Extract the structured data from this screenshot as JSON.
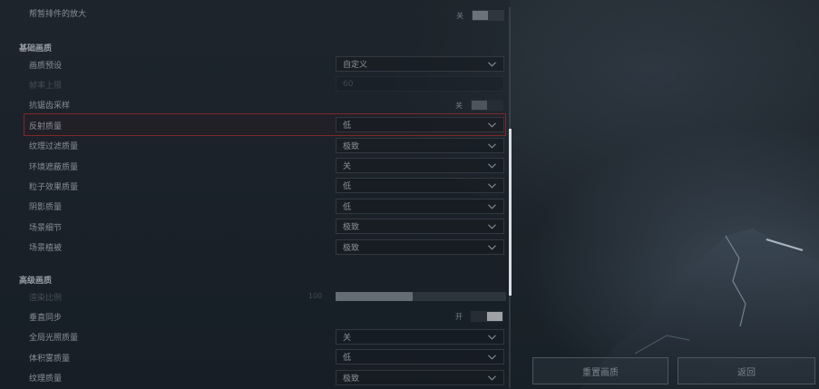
{
  "top_row": {
    "label": "帮暂排件的放大",
    "toggle_text": "关"
  },
  "basic_section": {
    "title": "基础画质",
    "rows": [
      {
        "label": "画质预设",
        "value": "自定义",
        "type": "dropdown",
        "disabled": false
      },
      {
        "label": "帧率上限",
        "value": "60",
        "type": "dropdown",
        "disabled": true
      },
      {
        "label": "抗锯齿采样",
        "value": "关",
        "type": "toggle",
        "disabled": false
      },
      {
        "label": "反射质量",
        "value": "低",
        "type": "dropdown",
        "disabled": false,
        "highlighted": true
      },
      {
        "label": "纹理过滤质量",
        "value": "极致",
        "type": "dropdown",
        "disabled": false
      },
      {
        "label": "环境遮蔽质量",
        "value": "关",
        "type": "dropdown",
        "disabled": false
      },
      {
        "label": "粒子效果质量",
        "value": "低",
        "type": "dropdown",
        "disabled": false
      },
      {
        "label": "阴影质量",
        "value": "低",
        "type": "dropdown",
        "disabled": false
      },
      {
        "label": "场景细节",
        "value": "极致",
        "type": "dropdown",
        "disabled": false
      },
      {
        "label": "场景植被",
        "value": "极致",
        "type": "dropdown",
        "disabled": false
      }
    ]
  },
  "advanced_section": {
    "title": "高级画质",
    "rows": [
      {
        "label": "渲染比例",
        "value": "100",
        "type": "slider",
        "disabled": true,
        "fill_fraction": 0.45
      },
      {
        "label": "垂直同步",
        "value": "开",
        "type": "toggle",
        "disabled": false
      },
      {
        "label": "全局光照质量",
        "value": "关",
        "type": "dropdown",
        "disabled": false
      },
      {
        "label": "体积雾质量",
        "value": "低",
        "type": "dropdown",
        "disabled": false
      },
      {
        "label": "纹理质量",
        "value": "极致",
        "type": "dropdown",
        "disabled": false
      }
    ]
  },
  "buttons": {
    "reset": "重置画质",
    "back": "返回"
  },
  "colors": {
    "highlight_border": "#b3302b",
    "toggle_on_knob": "#e6e9ec"
  }
}
